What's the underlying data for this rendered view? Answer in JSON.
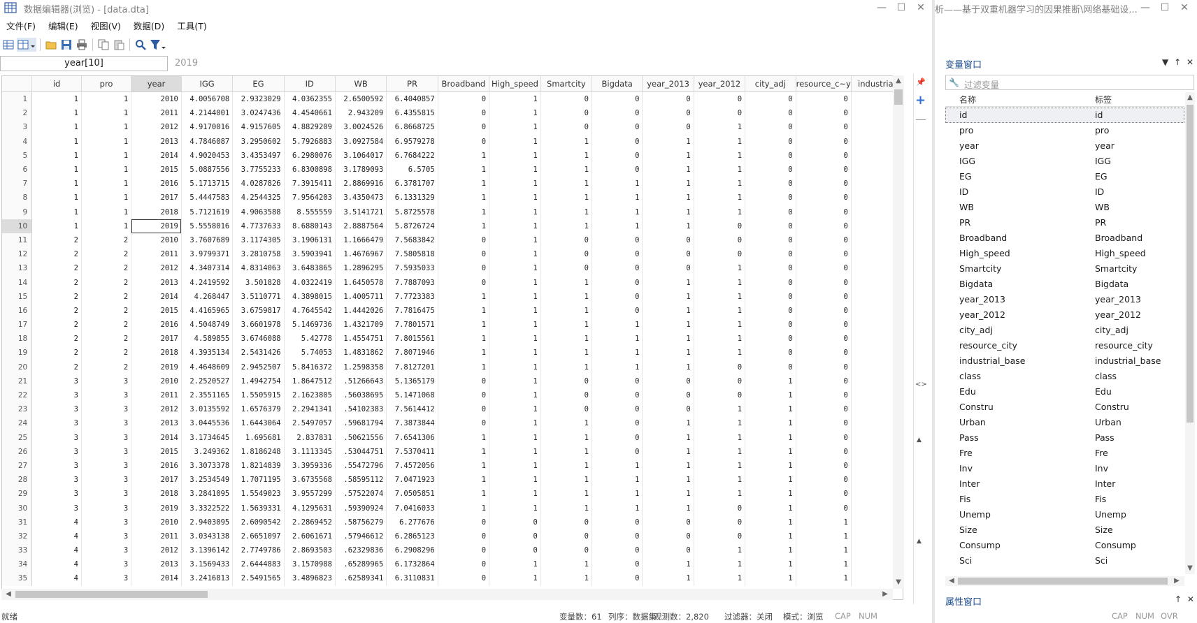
{
  "window": {
    "title": "数据编辑器(浏览) - [data.dta]",
    "second_title": "析——基于双重机器学习的因果推断\\网络基础设..."
  },
  "menu": [
    "文件(F)",
    "编辑(E)",
    "视图(V)",
    "数据(D)",
    "工具(T)"
  ],
  "toolbar": [
    "spreadsheet-icon",
    "grid-view-icon",
    "open-folder-icon",
    "save-icon",
    "print-icon",
    "copy-icon",
    "paste-icon",
    "search-icon",
    "filter-icon"
  ],
  "cellref": {
    "name": "year[10]",
    "value": "2019"
  },
  "grid": {
    "columns": [
      "id",
      "pro",
      "year",
      "IGG",
      "EG",
      "ID",
      "WB",
      "PR",
      "Broadband",
      "High_speed",
      "Smartcity",
      "Bigdata",
      "year_2013",
      "year_2012",
      "city_adj",
      "resource_c~y",
      "industrial"
    ],
    "selected_column": "year",
    "selected_row": 10,
    "rows": [
      [
        "1",
        "1",
        "2010",
        "4.0056708",
        "2.9323029",
        "4.0362355",
        "2.6500592",
        "6.4040857",
        "0",
        "1",
        "0",
        "0",
        "0",
        "0",
        "0",
        "0",
        ""
      ],
      [
        "1",
        "1",
        "2011",
        "4.2144001",
        "3.0247436",
        "4.4540661",
        "2.943209",
        "6.4355815",
        "0",
        "1",
        "0",
        "0",
        "0",
        "0",
        "0",
        "0",
        ""
      ],
      [
        "1",
        "1",
        "2012",
        "4.9170016",
        "4.9157605",
        "4.8829209",
        "3.0024526",
        "6.8668725",
        "0",
        "1",
        "0",
        "0",
        "0",
        "1",
        "0",
        "0",
        ""
      ],
      [
        "1",
        "1",
        "2013",
        "4.7846087",
        "3.2950602",
        "5.7926883",
        "3.0927584",
        "6.9579278",
        "0",
        "1",
        "1",
        "0",
        "1",
        "1",
        "0",
        "0",
        ""
      ],
      [
        "1",
        "1",
        "2014",
        "4.9020453",
        "3.4353497",
        "6.2980076",
        "3.1064017",
        "6.7684222",
        "1",
        "1",
        "1",
        "0",
        "1",
        "1",
        "0",
        "0",
        ""
      ],
      [
        "1",
        "1",
        "2015",
        "5.0887556",
        "3.7755233",
        "6.8300898",
        "3.1789093",
        "6.5705",
        "1",
        "1",
        "1",
        "0",
        "1",
        "1",
        "0",
        "0",
        ""
      ],
      [
        "1",
        "1",
        "2016",
        "5.1713715",
        "4.0287826",
        "7.3915411",
        "2.8869916",
        "6.3781707",
        "1",
        "1",
        "1",
        "1",
        "1",
        "1",
        "0",
        "0",
        ""
      ],
      [
        "1",
        "1",
        "2017",
        "5.4447583",
        "4.2544325",
        "7.9564203",
        "3.4350473",
        "6.1331329",
        "1",
        "1",
        "1",
        "1",
        "1",
        "1",
        "0",
        "0",
        ""
      ],
      [
        "1",
        "1",
        "2018",
        "5.7121619",
        "4.9063588",
        "8.555559",
        "3.5141721",
        "5.8725578",
        "1",
        "1",
        "1",
        "1",
        "1",
        "1",
        "0",
        "0",
        ""
      ],
      [
        "1",
        "1",
        "2019",
        "5.5558016",
        "4.7737633",
        "8.6880143",
        "2.8887564",
        "5.8726724",
        "1",
        "1",
        "1",
        "1",
        "1",
        "0",
        "0",
        "0",
        ""
      ],
      [
        "2",
        "2",
        "2010",
        "3.7607689",
        "3.1174305",
        "3.1906131",
        "1.1666479",
        "7.5683842",
        "0",
        "1",
        "0",
        "0",
        "0",
        "0",
        "0",
        "0",
        ""
      ],
      [
        "2",
        "2",
        "2011",
        "3.9799371",
        "3.2810758",
        "3.5903941",
        "1.4676967",
        "7.5805818",
        "0",
        "1",
        "0",
        "0",
        "0",
        "0",
        "0",
        "0",
        ""
      ],
      [
        "2",
        "2",
        "2012",
        "4.3407314",
        "4.8314063",
        "3.6483865",
        "1.2896295",
        "7.5935033",
        "0",
        "1",
        "0",
        "0",
        "0",
        "1",
        "0",
        "0",
        ""
      ],
      [
        "2",
        "2",
        "2013",
        "4.2419592",
        "3.501828",
        "4.0322419",
        "1.6450578",
        "7.7887093",
        "0",
        "1",
        "1",
        "0",
        "1",
        "1",
        "0",
        "0",
        ""
      ],
      [
        "2",
        "2",
        "2014",
        "4.268447",
        "3.5110771",
        "4.3898015",
        "1.4005711",
        "7.7723383",
        "1",
        "1",
        "1",
        "0",
        "1",
        "1",
        "0",
        "0",
        ""
      ],
      [
        "2",
        "2",
        "2015",
        "4.4165965",
        "3.6759817",
        "4.7645542",
        "1.4442026",
        "7.7816475",
        "1",
        "1",
        "1",
        "0",
        "1",
        "1",
        "0",
        "0",
        ""
      ],
      [
        "2",
        "2",
        "2016",
        "4.5048749",
        "3.6601978",
        "5.1469736",
        "1.4321709",
        "7.7801571",
        "1",
        "1",
        "1",
        "1",
        "1",
        "1",
        "0",
        "0",
        ""
      ],
      [
        "2",
        "2",
        "2017",
        "4.589855",
        "3.6746088",
        "5.42778",
        "1.4554751",
        "7.8015561",
        "1",
        "1",
        "1",
        "1",
        "1",
        "1",
        "0",
        "0",
        ""
      ],
      [
        "2",
        "2",
        "2018",
        "4.3935134",
        "2.5431426",
        "5.74053",
        "1.4831862",
        "7.8071946",
        "1",
        "1",
        "1",
        "1",
        "1",
        "1",
        "0",
        "0",
        ""
      ],
      [
        "2",
        "2",
        "2019",
        "4.4648609",
        "2.9452507",
        "5.8416372",
        "1.2598358",
        "7.8127201",
        "1",
        "1",
        "1",
        "1",
        "1",
        "0",
        "0",
        "0",
        ""
      ],
      [
        "3",
        "3",
        "2010",
        "2.2520527",
        "1.4942754",
        "1.8647512",
        ".51266643",
        "5.1365179",
        "0",
        "1",
        "0",
        "0",
        "0",
        "0",
        "1",
        "0",
        ""
      ],
      [
        "3",
        "3",
        "2011",
        "2.3551165",
        "1.5505915",
        "2.1623805",
        ".56038695",
        "5.1471068",
        "0",
        "1",
        "0",
        "0",
        "0",
        "0",
        "1",
        "0",
        ""
      ],
      [
        "3",
        "3",
        "2012",
        "3.0135592",
        "1.6576379",
        "2.2941341",
        ".54102383",
        "7.5614412",
        "0",
        "1",
        "0",
        "0",
        "0",
        "1",
        "1",
        "0",
        ""
      ],
      [
        "3",
        "3",
        "2013",
        "3.0445536",
        "1.6443064",
        "2.5497057",
        ".59681794",
        "7.3873844",
        "0",
        "1",
        "1",
        "0",
        "1",
        "1",
        "1",
        "0",
        ""
      ],
      [
        "3",
        "3",
        "2014",
        "3.1734645",
        "1.695681",
        "2.837831",
        ".50621556",
        "7.6541306",
        "1",
        "1",
        "1",
        "0",
        "1",
        "1",
        "1",
        "0",
        ""
      ],
      [
        "3",
        "3",
        "2015",
        "3.249362",
        "1.8186248",
        "3.1113345",
        ".53044751",
        "7.5370411",
        "1",
        "1",
        "1",
        "0",
        "1",
        "1",
        "1",
        "0",
        ""
      ],
      [
        "3",
        "3",
        "2016",
        "3.3073378",
        "1.8214839",
        "3.3959336",
        ".55472796",
        "7.4572056",
        "1",
        "1",
        "1",
        "1",
        "1",
        "1",
        "1",
        "0",
        ""
      ],
      [
        "3",
        "3",
        "2017",
        "3.2534549",
        "1.7071195",
        "3.6735568",
        ".58595112",
        "7.0471923",
        "1",
        "1",
        "1",
        "1",
        "1",
        "1",
        "1",
        "0",
        ""
      ],
      [
        "3",
        "3",
        "2018",
        "3.2841095",
        "1.5549023",
        "3.9557299",
        ".57522074",
        "7.0505851",
        "1",
        "1",
        "1",
        "1",
        "1",
        "1",
        "1",
        "0",
        ""
      ],
      [
        "3",
        "3",
        "2019",
        "3.3322522",
        "1.5639331",
        "4.1295631",
        ".59390924",
        "7.0416033",
        "1",
        "1",
        "1",
        "1",
        "1",
        "0",
        "1",
        "0",
        ""
      ],
      [
        "4",
        "3",
        "2010",
        "2.9403095",
        "2.6090542",
        "2.2869452",
        ".58756279",
        "6.277676",
        "0",
        "0",
        "0",
        "0",
        "0",
        "0",
        "1",
        "1",
        ""
      ],
      [
        "4",
        "3",
        "2011",
        "3.0343138",
        "2.6651097",
        "2.6061671",
        ".57946612",
        "6.2865123",
        "0",
        "0",
        "0",
        "0",
        "0",
        "0",
        "1",
        "1",
        ""
      ],
      [
        "4",
        "3",
        "2012",
        "3.1396142",
        "2.7749786",
        "2.8693503",
        ".62329836",
        "6.2908296",
        "0",
        "0",
        "0",
        "0",
        "0",
        "1",
        "1",
        "1",
        ""
      ],
      [
        "4",
        "3",
        "2013",
        "3.1569433",
        "2.6444883",
        "3.1570988",
        ".65289965",
        "6.1732864",
        "0",
        "1",
        "1",
        "0",
        "1",
        "1",
        "1",
        "1",
        ""
      ],
      [
        "4",
        "3",
        "2014",
        "3.2416813",
        "2.5491565",
        "3.4896823",
        ".62589341",
        "6.3110831",
        "0",
        "1",
        "1",
        "0",
        "1",
        "1",
        "1",
        "1",
        ""
      ]
    ]
  },
  "status": {
    "ready": "就绪",
    "vars": "变量数：61",
    "order": "列序：数据集",
    "obs": "观测数：2,820",
    "filter": "过滤器：关闭",
    "mode": "模式：浏览",
    "cap": "CAP",
    "num": "NUM",
    "right_cap": "CAP",
    "right_num": "NUM",
    "right_ovr": "OVR"
  },
  "var_window": {
    "title": "变量窗口",
    "filter_placeholder": "过滤变量",
    "col_name": "名称",
    "col_label": "标签",
    "vars": [
      [
        "id",
        "id"
      ],
      [
        "pro",
        "pro"
      ],
      [
        "year",
        "year"
      ],
      [
        "IGG",
        "IGG"
      ],
      [
        "EG",
        "EG"
      ],
      [
        "ID",
        "ID"
      ],
      [
        "WB",
        "WB"
      ],
      [
        "PR",
        "PR"
      ],
      [
        "Broadband",
        "Broadband"
      ],
      [
        "High_speed",
        "High_speed"
      ],
      [
        "Smartcity",
        "Smartcity"
      ],
      [
        "Bigdata",
        "Bigdata"
      ],
      [
        "year_2013",
        "year_2013"
      ],
      [
        "year_2012",
        "year_2012"
      ],
      [
        "city_adj",
        "city_adj"
      ],
      [
        "resource_city",
        "resource_city"
      ],
      [
        "industrial_base",
        "industrial_base"
      ],
      [
        "class",
        "class"
      ],
      [
        "Edu",
        "Edu"
      ],
      [
        "Constru",
        "Constru"
      ],
      [
        "Urban",
        "Urban"
      ],
      [
        "Pass",
        "Pass"
      ],
      [
        "Fre",
        "Fre"
      ],
      [
        "Inv",
        "Inv"
      ],
      [
        "Inter",
        "Inter"
      ],
      [
        "Fis",
        "Fis"
      ],
      [
        "Unemp",
        "Unemp"
      ],
      [
        "Size",
        "Size"
      ],
      [
        "Consump",
        "Consump"
      ],
      [
        "Sci",
        "Sci"
      ]
    ]
  },
  "prop_window": {
    "title": "属性窗口"
  },
  "colors": {
    "accent": "#1f4e8f",
    "selected_header": "#dcdcdc",
    "grid_border": "#e6e6e6"
  }
}
